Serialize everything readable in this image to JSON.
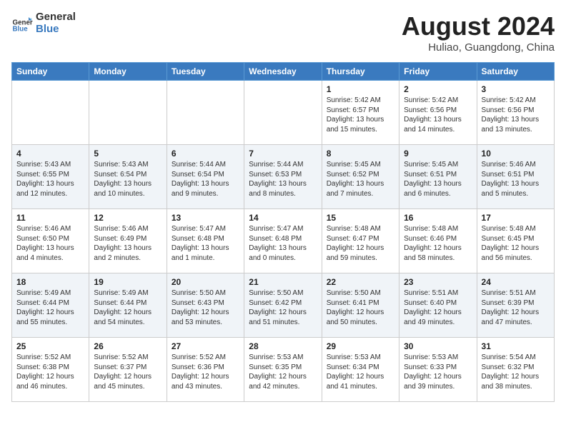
{
  "logo": {
    "line1": "General",
    "line2": "Blue"
  },
  "title": "August 2024",
  "location": "Huliao, Guangdong, China",
  "days_of_week": [
    "Sunday",
    "Monday",
    "Tuesday",
    "Wednesday",
    "Thursday",
    "Friday",
    "Saturday"
  ],
  "weeks": [
    [
      {
        "day": "",
        "info": ""
      },
      {
        "day": "",
        "info": ""
      },
      {
        "day": "",
        "info": ""
      },
      {
        "day": "",
        "info": ""
      },
      {
        "day": "1",
        "info": "Sunrise: 5:42 AM\nSunset: 6:57 PM\nDaylight: 13 hours\nand 15 minutes."
      },
      {
        "day": "2",
        "info": "Sunrise: 5:42 AM\nSunset: 6:56 PM\nDaylight: 13 hours\nand 14 minutes."
      },
      {
        "day": "3",
        "info": "Sunrise: 5:42 AM\nSunset: 6:56 PM\nDaylight: 13 hours\nand 13 minutes."
      }
    ],
    [
      {
        "day": "4",
        "info": "Sunrise: 5:43 AM\nSunset: 6:55 PM\nDaylight: 13 hours\nand 12 minutes."
      },
      {
        "day": "5",
        "info": "Sunrise: 5:43 AM\nSunset: 6:54 PM\nDaylight: 13 hours\nand 10 minutes."
      },
      {
        "day": "6",
        "info": "Sunrise: 5:44 AM\nSunset: 6:54 PM\nDaylight: 13 hours\nand 9 minutes."
      },
      {
        "day": "7",
        "info": "Sunrise: 5:44 AM\nSunset: 6:53 PM\nDaylight: 13 hours\nand 8 minutes."
      },
      {
        "day": "8",
        "info": "Sunrise: 5:45 AM\nSunset: 6:52 PM\nDaylight: 13 hours\nand 7 minutes."
      },
      {
        "day": "9",
        "info": "Sunrise: 5:45 AM\nSunset: 6:51 PM\nDaylight: 13 hours\nand 6 minutes."
      },
      {
        "day": "10",
        "info": "Sunrise: 5:46 AM\nSunset: 6:51 PM\nDaylight: 13 hours\nand 5 minutes."
      }
    ],
    [
      {
        "day": "11",
        "info": "Sunrise: 5:46 AM\nSunset: 6:50 PM\nDaylight: 13 hours\nand 4 minutes."
      },
      {
        "day": "12",
        "info": "Sunrise: 5:46 AM\nSunset: 6:49 PM\nDaylight: 13 hours\nand 2 minutes."
      },
      {
        "day": "13",
        "info": "Sunrise: 5:47 AM\nSunset: 6:48 PM\nDaylight: 13 hours\nand 1 minute."
      },
      {
        "day": "14",
        "info": "Sunrise: 5:47 AM\nSunset: 6:48 PM\nDaylight: 13 hours\nand 0 minutes."
      },
      {
        "day": "15",
        "info": "Sunrise: 5:48 AM\nSunset: 6:47 PM\nDaylight: 12 hours\nand 59 minutes."
      },
      {
        "day": "16",
        "info": "Sunrise: 5:48 AM\nSunset: 6:46 PM\nDaylight: 12 hours\nand 58 minutes."
      },
      {
        "day": "17",
        "info": "Sunrise: 5:48 AM\nSunset: 6:45 PM\nDaylight: 12 hours\nand 56 minutes."
      }
    ],
    [
      {
        "day": "18",
        "info": "Sunrise: 5:49 AM\nSunset: 6:44 PM\nDaylight: 12 hours\nand 55 minutes."
      },
      {
        "day": "19",
        "info": "Sunrise: 5:49 AM\nSunset: 6:44 PM\nDaylight: 12 hours\nand 54 minutes."
      },
      {
        "day": "20",
        "info": "Sunrise: 5:50 AM\nSunset: 6:43 PM\nDaylight: 12 hours\nand 53 minutes."
      },
      {
        "day": "21",
        "info": "Sunrise: 5:50 AM\nSunset: 6:42 PM\nDaylight: 12 hours\nand 51 minutes."
      },
      {
        "day": "22",
        "info": "Sunrise: 5:50 AM\nSunset: 6:41 PM\nDaylight: 12 hours\nand 50 minutes."
      },
      {
        "day": "23",
        "info": "Sunrise: 5:51 AM\nSunset: 6:40 PM\nDaylight: 12 hours\nand 49 minutes."
      },
      {
        "day": "24",
        "info": "Sunrise: 5:51 AM\nSunset: 6:39 PM\nDaylight: 12 hours\nand 47 minutes."
      }
    ],
    [
      {
        "day": "25",
        "info": "Sunrise: 5:52 AM\nSunset: 6:38 PM\nDaylight: 12 hours\nand 46 minutes."
      },
      {
        "day": "26",
        "info": "Sunrise: 5:52 AM\nSunset: 6:37 PM\nDaylight: 12 hours\nand 45 minutes."
      },
      {
        "day": "27",
        "info": "Sunrise: 5:52 AM\nSunset: 6:36 PM\nDaylight: 12 hours\nand 43 minutes."
      },
      {
        "day": "28",
        "info": "Sunrise: 5:53 AM\nSunset: 6:35 PM\nDaylight: 12 hours\nand 42 minutes."
      },
      {
        "day": "29",
        "info": "Sunrise: 5:53 AM\nSunset: 6:34 PM\nDaylight: 12 hours\nand 41 minutes."
      },
      {
        "day": "30",
        "info": "Sunrise: 5:53 AM\nSunset: 6:33 PM\nDaylight: 12 hours\nand 39 minutes."
      },
      {
        "day": "31",
        "info": "Sunrise: 5:54 AM\nSunset: 6:32 PM\nDaylight: 12 hours\nand 38 minutes."
      }
    ]
  ]
}
